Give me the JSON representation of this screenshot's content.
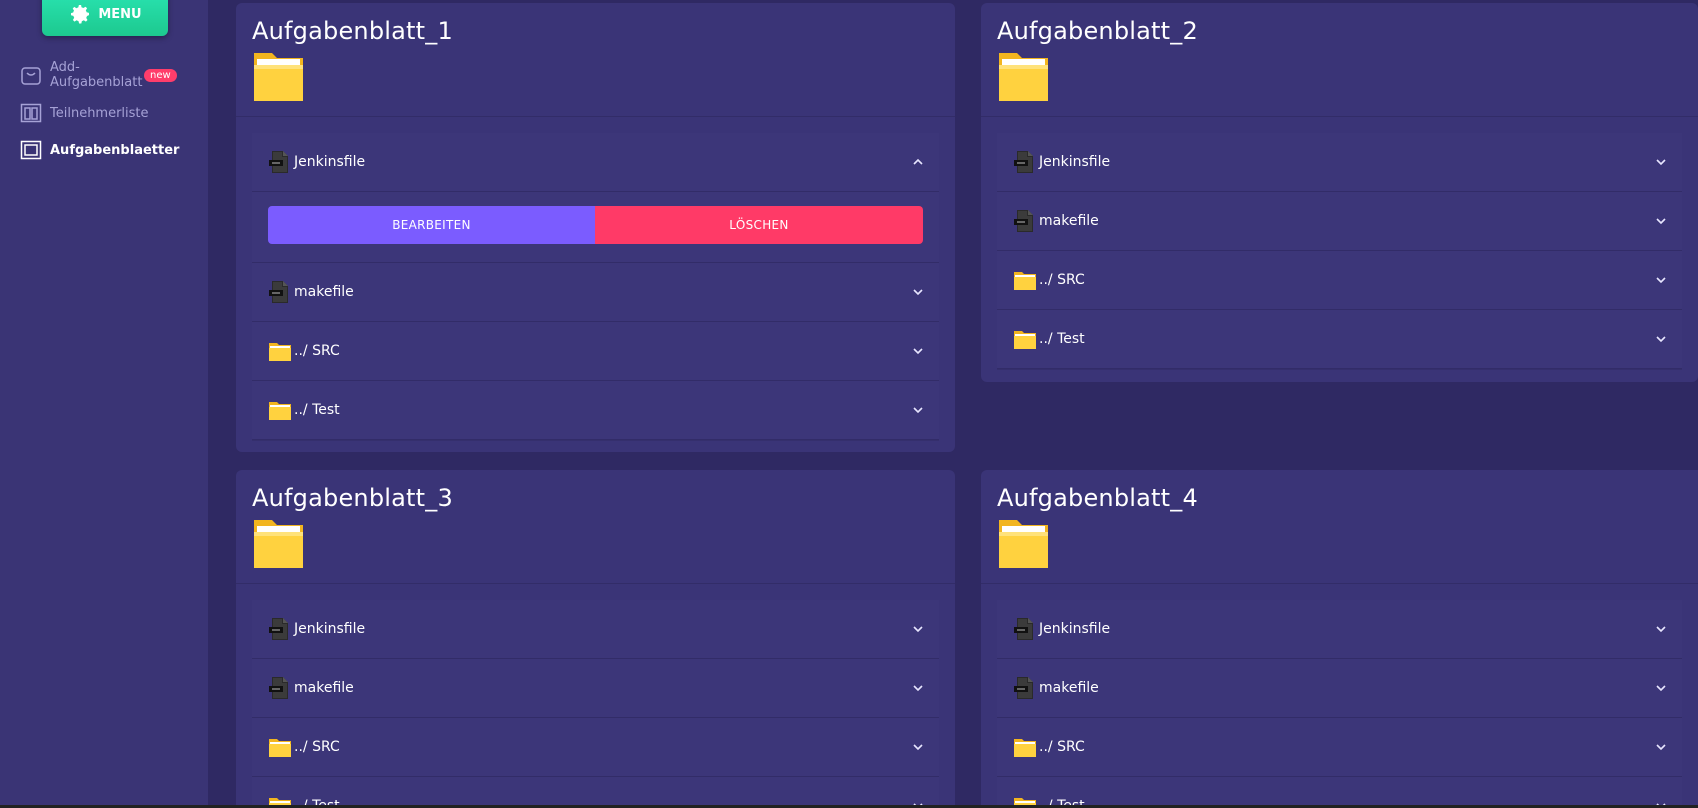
{
  "sidebar": {
    "menu_label": "MENU",
    "items": [
      {
        "label": "Add-Aufgabenblatt",
        "badge": "new"
      },
      {
        "label": "Teilnehmerliste"
      },
      {
        "label": "Aufgabenblaetter"
      }
    ]
  },
  "cards": [
    {
      "title": "Aufgabenblatt_1",
      "rows": [
        "Jenkinsfile",
        "makefile",
        "../ SRC",
        "../ Test"
      ],
      "actions": {
        "edit": "BEARBEITEN",
        "delete": "LÖSCHEN"
      }
    },
    {
      "title": "Aufgabenblatt_2",
      "rows": [
        "Jenkinsfile",
        "makefile",
        "../ SRC",
        "../ Test"
      ]
    },
    {
      "title": "Aufgabenblatt_3",
      "rows": [
        "Jenkinsfile",
        "makefile",
        "../ SRC",
        "../ Test"
      ]
    },
    {
      "title": "Aufgabenblatt_4",
      "rows": [
        "Jenkinsfile",
        "makefile",
        "../ SRC",
        "../ Test"
      ]
    }
  ],
  "colors": {
    "accent_edit": "#7b5cff",
    "accent_delete": "#ff3a67",
    "menu": "#1fd69c",
    "badge": "#ff3d6b"
  }
}
